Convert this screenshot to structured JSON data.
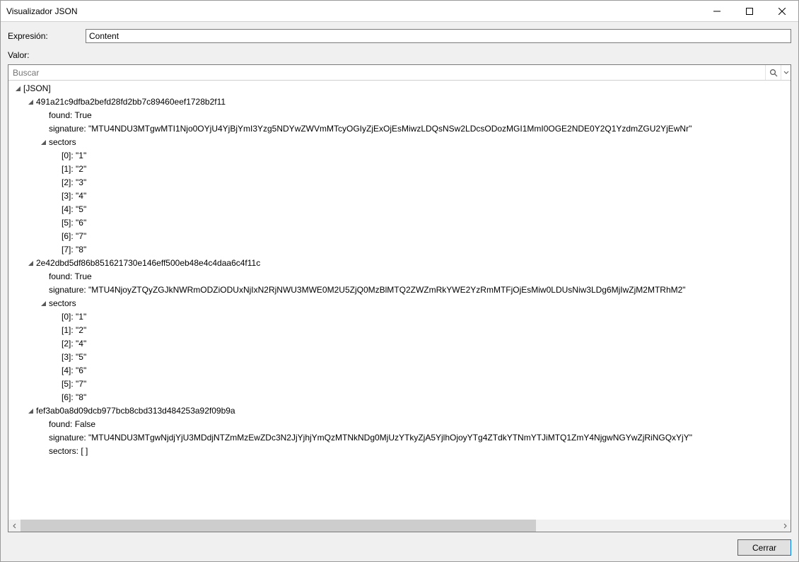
{
  "window": {
    "title": "Visualizador JSON"
  },
  "labels": {
    "expression": "Expresión:",
    "value": "Valor:",
    "close": "Cerrar"
  },
  "expression": {
    "value": "Content"
  },
  "search": {
    "placeholder": "Buscar"
  },
  "tree": {
    "root_label": "[JSON]",
    "found_key": "found",
    "signature_key": "signature",
    "sectors_key": "sectors",
    "true_label": "True",
    "false_label": "False",
    "entries": [
      {
        "key": "491a21c9dfba2befd28fd2bb7c89460eef1728b2f11",
        "found": true,
        "signature": "MTU4NDU3MTgwMTI1Njo0OYjU4YjBjYmI3Yzg5NDYwZWVmMTcyOGIyZjExOjEsMiwzLDQsNSw2LDcsODozMGI1MmI0OGE2NDE0Y2Q1YzdmZGU2YjEwNr",
        "sectors": [
          "1",
          "2",
          "3",
          "4",
          "5",
          "6",
          "7",
          "8"
        ]
      },
      {
        "key": "2e42dbd5df86b851621730e146eff500eb48e4c4daa6c4f11c",
        "found": true,
        "signature": "MTU4NjoyZTQyZGJkNWRmODZiODUxNjIxN2RjNWU3MWE0M2U5ZjQ0MzBlMTQ2ZWZmRkYWE2YzRmMTFjOjEsMiw0LDUsNiw3LDg6MjIwZjM2MTRhM2",
        "sectors": [
          "1",
          "2",
          "4",
          "5",
          "6",
          "7",
          "8"
        ]
      },
      {
        "key": "fef3ab0a8d09dcb977bcb8cbd313d484253a92f09b9a",
        "found": false,
        "signature": "MTU4NDU3MTgwNjdjYjU3MDdjNTZmMzEwZDc3N2JjYjhjYmQzMTNkNDg0MjUzYTkyZjA5YjlhOjoyYTg4ZTdkYTNmYTJiMTQ1ZmY4NjgwNGYwZjRiNGQxYjY",
        "sectors": []
      }
    ]
  }
}
